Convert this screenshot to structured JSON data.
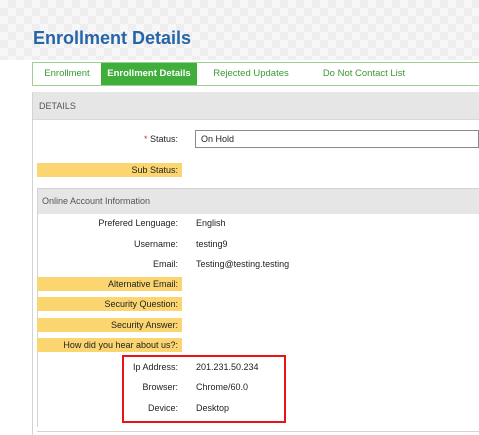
{
  "page": {
    "title": "Enrollment Details"
  },
  "tabs": [
    {
      "label": "Enrollment",
      "active": false
    },
    {
      "label": "Enrollment Details",
      "active": true
    },
    {
      "label": "Rejected Updates",
      "active": false
    },
    {
      "label": "Do Not Contact List",
      "active": false
    }
  ],
  "details": {
    "header": "DETAILS",
    "required_marker": "*",
    "status_label": "Status:",
    "status_value": "On Hold",
    "sub_status_label": "Sub Status:"
  },
  "online_account": {
    "header": "Online Account Information",
    "fields": [
      {
        "label": "Prefered Lenguage:",
        "value": "English",
        "highlighted": false
      },
      {
        "label": "Username:",
        "value": "testing9",
        "highlighted": false
      },
      {
        "label": "Email:",
        "value": "Testing@testing.testing",
        "highlighted": false
      },
      {
        "label": "Alternative Email:",
        "value": "",
        "highlighted": true
      },
      {
        "label": "Security Question:",
        "value": "",
        "highlighted": true
      },
      {
        "label": "Security Answer:",
        "value": "",
        "highlighted": true
      },
      {
        "label": "How did you hear about us?:",
        "value": "",
        "highlighted": true
      },
      {
        "label": "Ip Address:",
        "value": "201.231.50.234",
        "highlighted": false
      },
      {
        "label": "Browser:",
        "value": "Chrome/60.0",
        "highlighted": false
      },
      {
        "label": "Device:",
        "value": "Desktop",
        "highlighted": false
      }
    ]
  },
  "colors": {
    "title": "#2565a8",
    "tab_active_bg": "#3fae3a",
    "tab_text": "#3a9a33",
    "highlight_label_bg": "#fbd570",
    "annotation_box": "#e8141a"
  }
}
